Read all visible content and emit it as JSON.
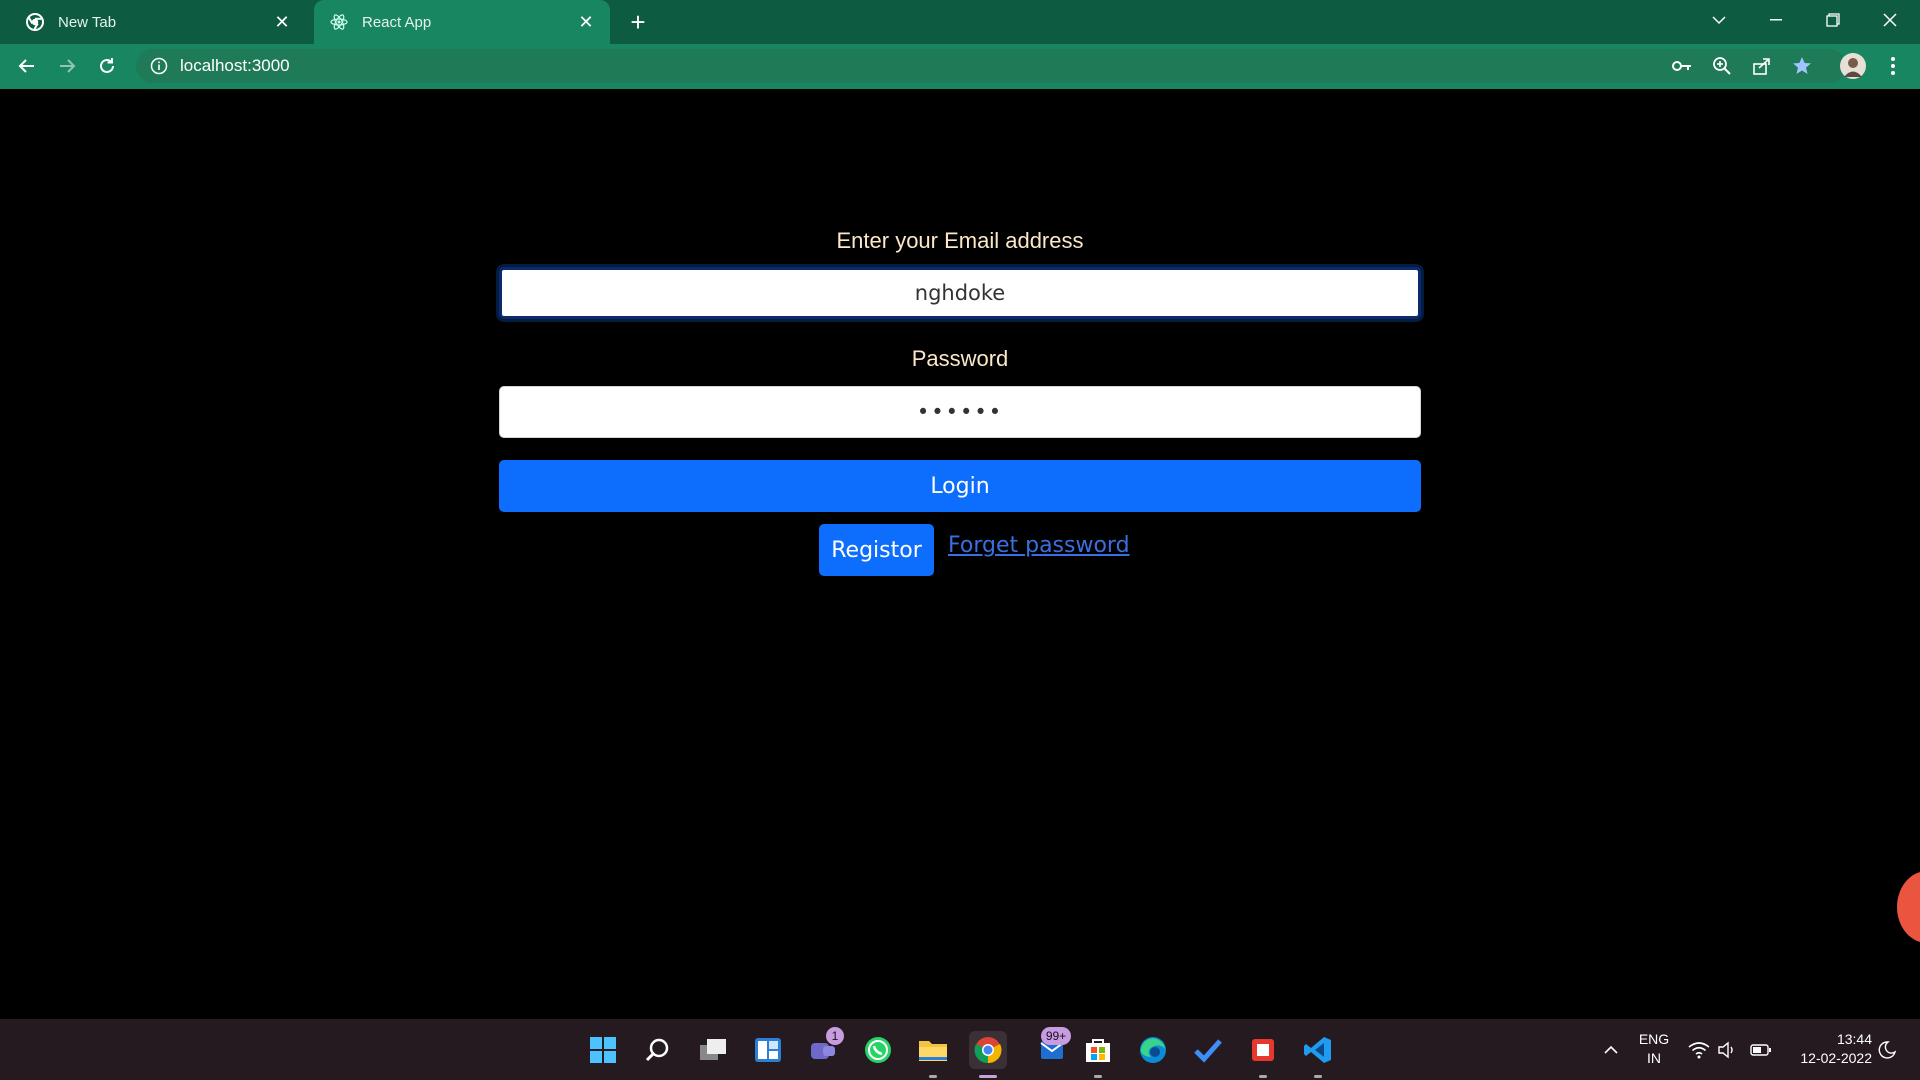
{
  "browser": {
    "tabs": [
      {
        "title": "New Tab",
        "icon": "chrome-icon",
        "active": false
      },
      {
        "title": "React App",
        "icon": "react-icon",
        "active": true
      }
    ],
    "address": "localhost:3000"
  },
  "form": {
    "email_label": "Enter your Email address",
    "email_value": "nghdoke",
    "password_label": "Password",
    "password_value": "••••••",
    "login_label": "Login",
    "register_label": "Registor",
    "forget_label": " Forget password"
  },
  "taskbar": {
    "teams_badge": "1",
    "mail_badge": "99+",
    "lang_1": "ENG",
    "lang_2": "IN",
    "time": "13:44",
    "date": "12-02-2022"
  },
  "colors": {
    "tabstrip": "#0d5c42",
    "toolbar": "#188660",
    "primary_button": "#0d6efd",
    "label_text": "#fce8c6",
    "link": "#3a6fe0"
  }
}
